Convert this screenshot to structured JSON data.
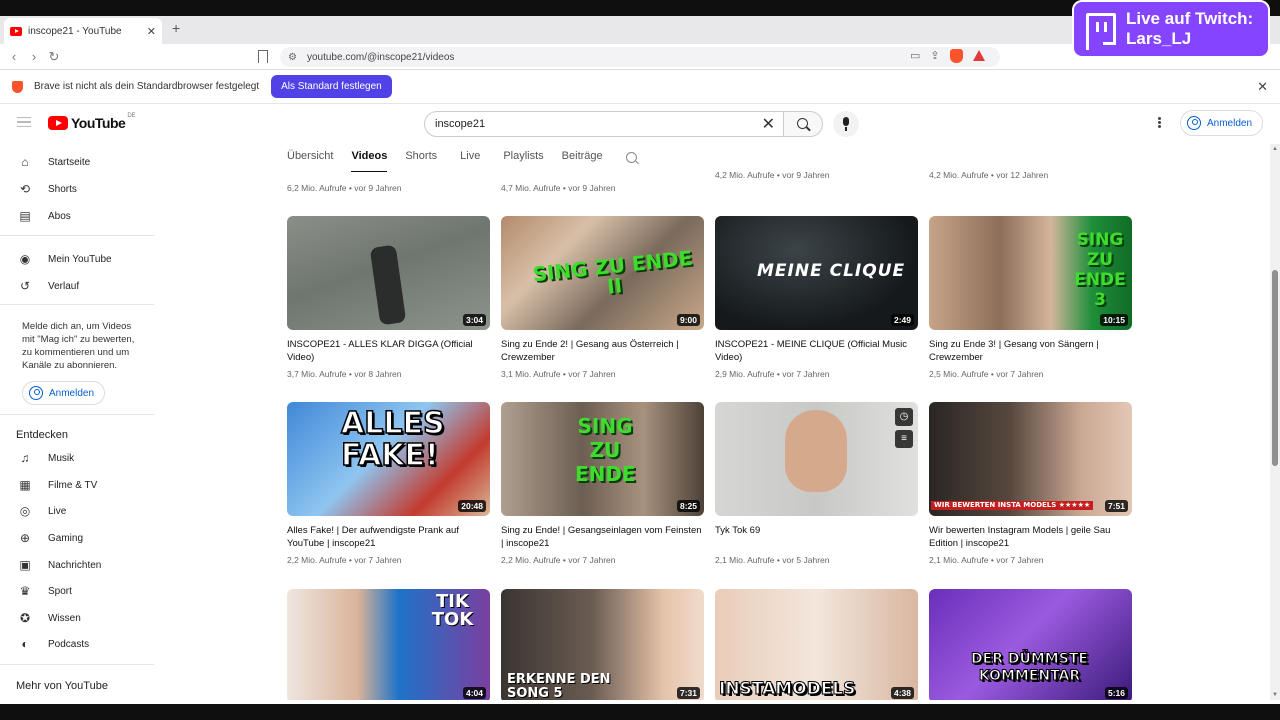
{
  "browser": {
    "tab_title": "inscope21 - YouTube",
    "url": "youtube.com/@inscope21/videos",
    "info_message": "Brave ist nicht als dein Standardbrowser festgelegt",
    "info_button": "Als Standard festlegen"
  },
  "twitch": {
    "line1": "Live auf Twitch:",
    "line2": "Lars_LJ"
  },
  "masthead": {
    "logo": "YouTube",
    "country": "DE",
    "search_value": "inscope21",
    "signin": "Anmelden"
  },
  "sidebar": {
    "main": [
      "Startseite",
      "Shorts",
      "Abos"
    ],
    "you": [
      "Mein YouTube",
      "Verlauf"
    ],
    "message": "Melde dich an, um Videos mit \"Mag ich\" zu bewerten, zu kommentieren und um Kanäle zu abonnieren.",
    "signin": "Anmelden",
    "explore_heading": "Entdecken",
    "explore": [
      "Musik",
      "Filme & TV",
      "Live",
      "Gaming",
      "Nachrichten",
      "Sport",
      "Wissen",
      "Podcasts"
    ],
    "more_heading": "Mehr von YouTube"
  },
  "channel_tabs": [
    "Übersicht",
    "Videos",
    "Shorts",
    "Live",
    "Playlists",
    "Beiträge"
  ],
  "previous_row_meta": [
    "6,2 Mio. Aufrufe • vor 9 Jahren",
    "4,7 Mio. Aufrufe • vor 9 Jahren",
    "4,2 Mio. Aufrufe • vor 9 Jahren",
    "4,2 Mio. Aufrufe • vor 12 Jahren"
  ],
  "videos": [
    {
      "title": "INSCOPE21 - ALLES KLAR DIGGA (Official Video)",
      "meta": "3,7 Mio. Aufrufe • vor 8 Jahren",
      "duration": "3:04"
    },
    {
      "title": "Sing zu Ende 2! | Gesang aus Österreich | Crewzember",
      "meta": "3,1 Mio. Aufrufe • vor 7 Jahren",
      "duration": "9:00",
      "overlay": "SING ZU ENDE II"
    },
    {
      "title": "INSCOPE21 - MEINE CLIQUE (Official Music Video)",
      "meta": "2,9 Mio. Aufrufe • vor 7 Jahren",
      "duration": "2:49",
      "overlay": "MEINE CLIQUE"
    },
    {
      "title": "Sing zu Ende 3! | Gesang von Sängern | Crewzember",
      "meta": "2,5 Mio. Aufrufe • vor 7 Jahren",
      "duration": "10:15",
      "overlay": "SING ZU ENDE 3"
    },
    {
      "title": "Alles Fake! | Der aufwendigste Prank auf YouTube | inscope21",
      "meta": "2,2 Mio. Aufrufe • vor 7 Jahren",
      "duration": "20:48",
      "overlay": "ALLES FAKE!"
    },
    {
      "title": "Sing zu Ende! | Gesangseinlagen vom Feinsten | inscope21",
      "meta": "2,2 Mio. Aufrufe • vor 7 Jahren",
      "duration": "8:25",
      "overlay": "SING ZU ENDE"
    },
    {
      "title": "Tyk Tok 69",
      "meta": "2,1 Mio. Aufrufe • vor 5 Jahren",
      "duration": ""
    },
    {
      "title": "Wir bewerten Instagram Models | geile Sau Edition | inscope21",
      "meta": "2,1 Mio. Aufrufe • vor 7 Jahren",
      "duration": "7:51",
      "overlay": "WIR BEWERTEN INSTA MODELS ★★★★★"
    },
    {
      "title": "",
      "meta": "",
      "duration": "4:04",
      "overlay": "TIK TOK"
    },
    {
      "title": "",
      "meta": "",
      "duration": "7:31",
      "overlay": "ERKENNE DEN SONG 5"
    },
    {
      "title": "",
      "meta": "",
      "duration": "4:38",
      "overlay": "INSTAMODELS"
    },
    {
      "title": "",
      "meta": "",
      "duration": "5:16",
      "overlay": "DER DÜMMSTE KOMMENTAR"
    }
  ],
  "colors": {
    "brave_accent": "#5142e8",
    "twitch": "#8544ff",
    "youtube_red": "#ff0000",
    "link_blue": "#065fd4"
  }
}
